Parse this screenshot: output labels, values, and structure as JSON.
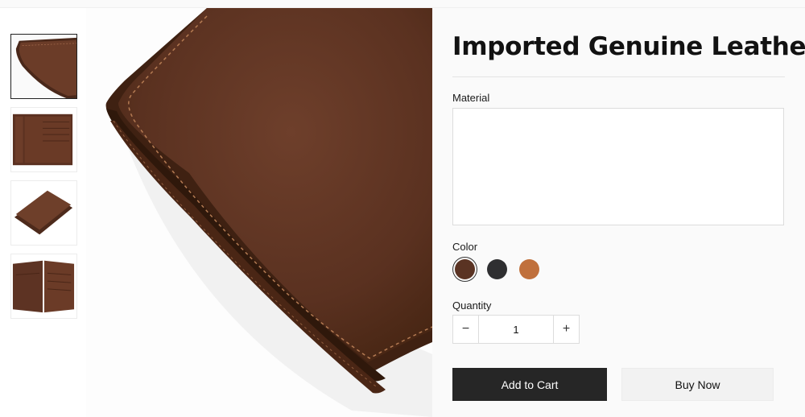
{
  "product": {
    "title": "Imported Genuine Leather",
    "thumbnails": [
      {
        "name": "wallet-closed-corner",
        "active": true
      },
      {
        "name": "wallet-open-front",
        "active": false
      },
      {
        "name": "wallet-closed-angled",
        "active": false
      },
      {
        "name": "wallet-open-cards",
        "active": false
      }
    ]
  },
  "form": {
    "material_label": "Material",
    "material_value": "",
    "color_label": "Color",
    "colors": [
      {
        "name": "brown",
        "hex": "#5a3323",
        "selected": true
      },
      {
        "name": "black",
        "hex": "#2f2f31",
        "selected": false
      },
      {
        "name": "tan",
        "hex": "#c0703c",
        "selected": false
      }
    ],
    "quantity_label": "Quantity",
    "quantity_value": "1",
    "minus_symbol": "−",
    "plus_symbol": "+"
  },
  "actions": {
    "add_to_cart": "Add to Cart",
    "buy_now": "Buy Now"
  }
}
